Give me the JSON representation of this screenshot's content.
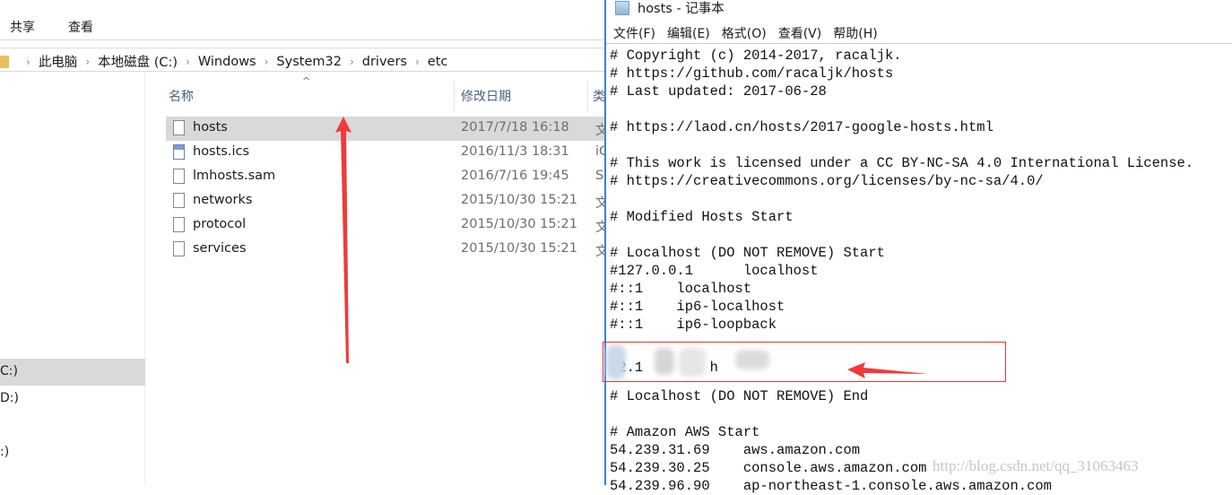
{
  "explorer": {
    "ribbon": {
      "share": "共享",
      "view": "查看"
    },
    "breadcrumb": [
      "此电脑",
      "本地磁盘 (C:)",
      "Windows",
      "System32",
      "drivers",
      "etc"
    ],
    "nav_items": [
      "C:)",
      "D:)",
      ":)"
    ],
    "columns": {
      "name": "名称",
      "modified": "修改日期",
      "type": "类"
    },
    "files": [
      {
        "name": "hosts",
        "date": "2017/7/18 16:18",
        "type": "文",
        "icon": "file-icon",
        "selected": true
      },
      {
        "name": "hosts.ics",
        "date": "2016/11/3 18:31",
        "type": "iC",
        "icon": "calendar-file-icon"
      },
      {
        "name": "lmhosts.sam",
        "date": "2016/7/16 19:45",
        "type": "SA",
        "icon": "file-icon"
      },
      {
        "name": "networks",
        "date": "2015/10/30 15:21",
        "type": "文",
        "icon": "file-icon"
      },
      {
        "name": "protocol",
        "date": "2015/10/30 15:21",
        "type": "文",
        "icon": "file-icon"
      },
      {
        "name": "services",
        "date": "2015/10/30 15:21",
        "type": "文",
        "icon": "file-icon"
      }
    ]
  },
  "notepad": {
    "title": "hosts - 记事本",
    "menu": [
      "文件(F)",
      "编辑(E)",
      "格式(O)",
      "查看(V)",
      "帮助(H)"
    ],
    "lines": [
      "# Copyright (c) 2014-2017, racaljk.",
      "# https://github.com/racaljk/hosts",
      "# Last updated: 2017-06-28",
      "",
      "# https://laod.cn/hosts/2017-google-hosts.html",
      "",
      "# This work is licensed under a CC BY-NC-SA 4.0 International License.",
      "# https://creativecommons.org/licenses/by-nc-sa/4.0/",
      "",
      "# Modified Hosts Start",
      "",
      "# Localhost (DO NOT REMOVE) Start",
      "#127.0.0.1      localhost",
      "#::1    localhost",
      "#::1    ip6-localhost",
      "#::1    ip6-loopback",
      "",
      " 2.1  .   8 h",
      "",
      "# Localhost (DO NOT REMOVE) End",
      "",
      "# Amazon AWS Start",
      "54.239.31.69    aws.amazon.com",
      "54.239.30.25    console.aws.amazon.com",
      "54.239.96.90    ap-northeast-1.console.aws.amazon.com"
    ]
  },
  "watermark": "http://blog.csdn.net/qq_31063463",
  "colors": {
    "annotation": "#f03a3a",
    "selection": "#d9d9d9",
    "window_border": "#3c7fd6"
  }
}
